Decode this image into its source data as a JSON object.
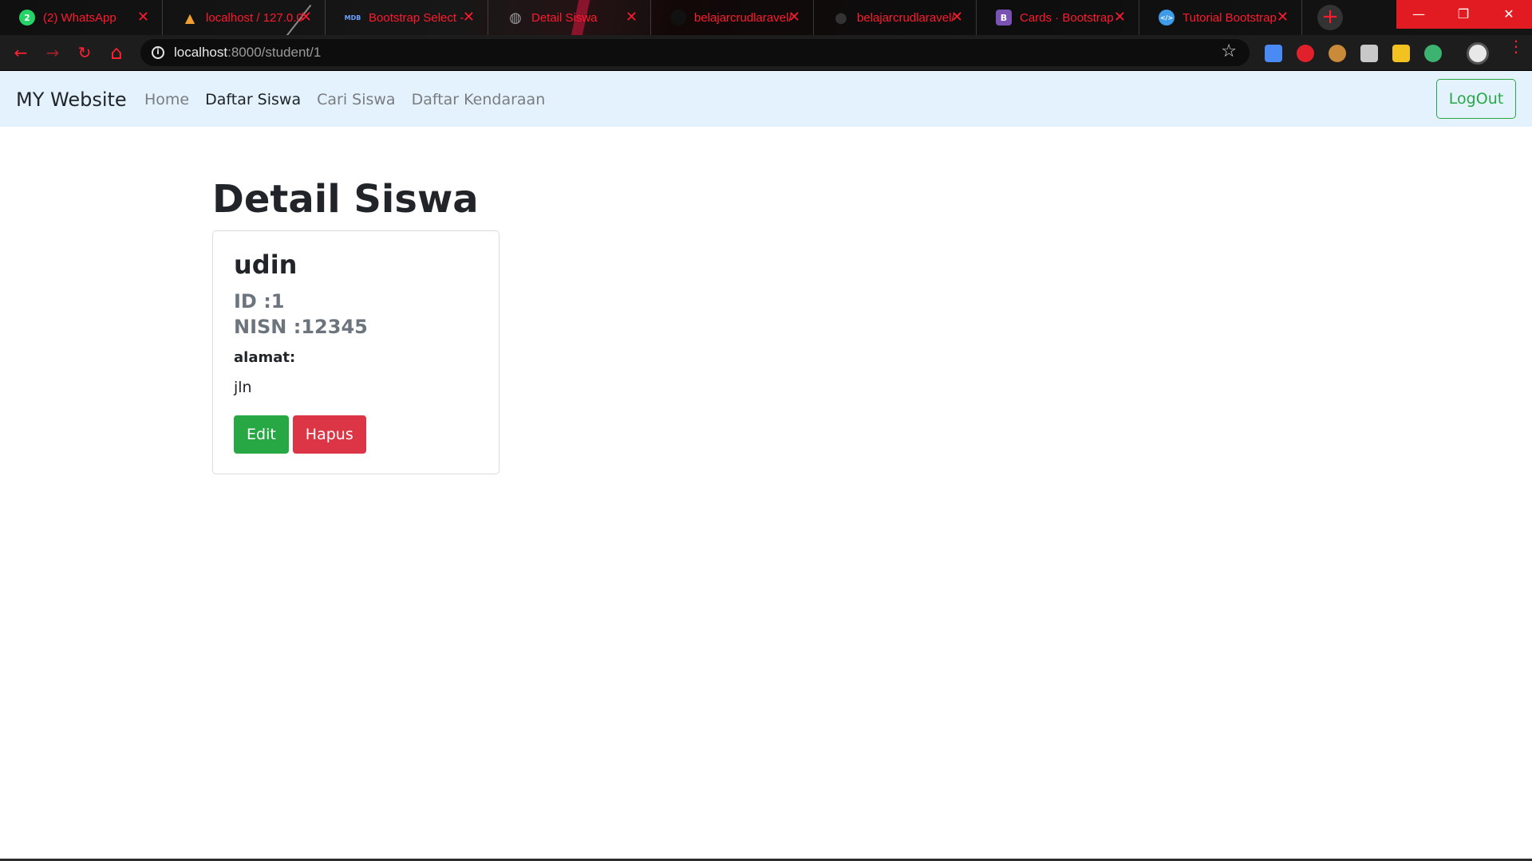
{
  "browser": {
    "tabs": [
      {
        "title": "(2) WhatsApp",
        "icon": "whatsapp-icon",
        "color": "#25d366",
        "glyph": "2"
      },
      {
        "title": "localhost / 127.0.0",
        "icon": "phpmyadmin-icon",
        "color": "#f0a030",
        "glyph": "▲"
      },
      {
        "title": "Bootstrap Select -",
        "icon": "mdb-icon",
        "color": "#3b5998",
        "glyph": "MDB"
      },
      {
        "title": "Detail Siswa",
        "icon": "globe-icon",
        "color": "#777777",
        "glyph": "◍"
      },
      {
        "title": "belajarcrudlaravel/",
        "icon": "github-icon",
        "color": "#111111",
        "glyph": ""
      },
      {
        "title": "belajarcrudlaravel/",
        "icon": "github-icon",
        "color": "#222222",
        "glyph": "●"
      },
      {
        "title": "Cards · Bootstrap",
        "icon": "bootstrap-icon",
        "color": "#7952b3",
        "glyph": "B"
      },
      {
        "title": "Tutorial Bootstrap",
        "icon": "code-icon",
        "color": "#3d9be9",
        "glyph": "</>"
      }
    ],
    "url_host": "localhost",
    "url_rest": ":8000/student/1",
    "new_tab": "+",
    "minimize": "—",
    "maximize": "❐",
    "close": "✕",
    "back": "←",
    "forward": "→",
    "reload": "↻",
    "home": "⌂",
    "star": "☆",
    "accent": "#ff1a2e"
  },
  "navbar": {
    "brand": "MY Website",
    "links": [
      "Home",
      "Daftar Siswa",
      "Cari Siswa",
      "Daftar Kendaraan"
    ],
    "active_index": 1,
    "logout": "LogOut"
  },
  "main": {
    "title": "Detail Siswa",
    "card": {
      "name": "udin",
      "id_line": "ID :1",
      "nisn_line": "NISN :12345",
      "alamat_label": "alamat:",
      "alamat_value": "jln",
      "edit_label": "Edit",
      "delete_label": "Hapus"
    }
  },
  "colors": {
    "navbar_bg": "#e3f2fd",
    "success": "#28a745",
    "danger": "#dc3545"
  }
}
